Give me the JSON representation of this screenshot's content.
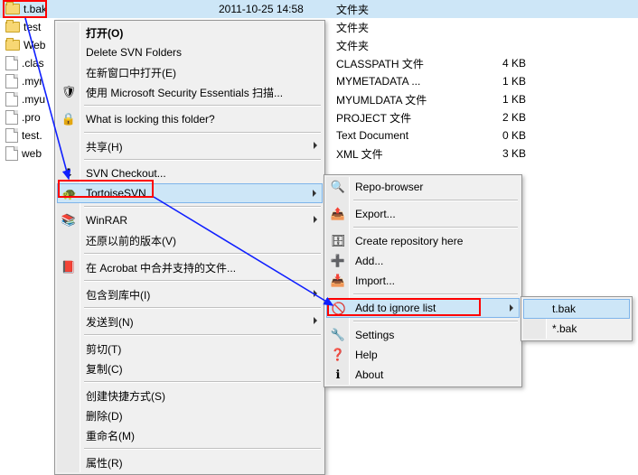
{
  "files": [
    {
      "name": "t.bak",
      "icon": "folder",
      "date": "2011-10-25 14:58",
      "type": "文件夹",
      "size": ""
    },
    {
      "name": "test",
      "icon": "folder",
      "date": "",
      "type": "文件夹",
      "size": ""
    },
    {
      "name": "Web",
      "icon": "folder",
      "date": "",
      "type": "文件夹",
      "size": ""
    },
    {
      "name": ".clas",
      "icon": "file",
      "date": "",
      "type": "CLASSPATH 文件",
      "size": "4 KB"
    },
    {
      "name": ".myr",
      "icon": "file",
      "date": "",
      "type": "MYMETADATA ...",
      "size": "1 KB"
    },
    {
      "name": ".myu",
      "icon": "file",
      "date": "",
      "type": "MYUMLDATA 文件",
      "size": "1 KB"
    },
    {
      "name": ".pro",
      "icon": "file",
      "date": "",
      "type": "PROJECT 文件",
      "size": "2 KB"
    },
    {
      "name": "test.",
      "icon": "file",
      "date": "",
      "type": "Text Document",
      "size": "0 KB"
    },
    {
      "name": "web",
      "icon": "file",
      "date": "",
      "type": "XML 文件",
      "size": "3 KB"
    }
  ],
  "m1": {
    "open": "打开(O)",
    "delete_svn": "Delete SVN Folders",
    "new_window": "在新窗口中打开(E)",
    "mse": "使用 Microsoft Security Essentials 扫描...",
    "lock": "What is locking this folder?",
    "share": "共享(H)",
    "checkout": "SVN Checkout...",
    "tortoise": "TortoiseSVN",
    "winrar": "WinRAR",
    "restore": "还原以前的版本(V)",
    "acrobat": "在 Acrobat 中合并支持的文件...",
    "library": "包含到库中(I)",
    "sendto": "发送到(N)",
    "cut": "剪切(T)",
    "copy": "复制(C)",
    "shortcut": "创建快捷方式(S)",
    "delete": "删除(D)",
    "rename": "重命名(M)",
    "props": "属性(R)"
  },
  "m2": {
    "repo": "Repo-browser",
    "export": "Export...",
    "create": "Create repository here",
    "add": "Add...",
    "import": "Import...",
    "ignore": "Add to ignore list",
    "settings": "Settings",
    "help": "Help",
    "about": "About"
  },
  "m3": {
    "exact": "t.bak",
    "glob": "*.bak"
  },
  "icons": {
    "mse": "🛡",
    "lock": "🔒",
    "checkout": "⬇",
    "tortoise": "🐢",
    "winrar": "📚",
    "acrobat": "📕",
    "repo": "🔍",
    "export": "📤",
    "create": "🗄",
    "add": "➕",
    "import": "📥",
    "ignore": "🚫",
    "settings": "🔧",
    "help": "❓",
    "about": "ℹ"
  }
}
